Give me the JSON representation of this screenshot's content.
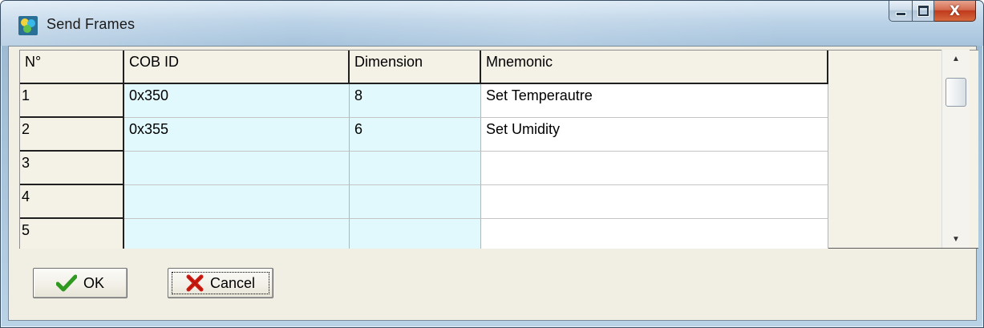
{
  "window": {
    "title": "Send Frames",
    "icons": {
      "app": "app-icon",
      "minimize": "minimize-icon",
      "maximize": "maximize-icon",
      "close": "close-icon",
      "close_glyph": "X"
    }
  },
  "grid": {
    "columns": [
      "N°",
      "COB ID",
      "Dimension",
      "Mnemonic"
    ],
    "rows": [
      {
        "n": "1",
        "cob_id": "0x350",
        "dimension": "8",
        "mnemonic": "Set Temperautre"
      },
      {
        "n": "2",
        "cob_id": "0x355",
        "dimension": "6",
        "mnemonic": "Set Umidity"
      },
      {
        "n": "3",
        "cob_id": "",
        "dimension": "",
        "mnemonic": ""
      },
      {
        "n": "4",
        "cob_id": "",
        "dimension": "",
        "mnemonic": ""
      },
      {
        "n": "5",
        "cob_id": "",
        "dimension": "",
        "mnemonic": ""
      }
    ],
    "colors": {
      "editable_cell": "#e1f9fd",
      "text_cell": "#ffffff",
      "fixed": "#f4f2e7"
    }
  },
  "buttons": {
    "ok": {
      "label": "OK",
      "icon": "checkmark-icon",
      "color": "#2f9a1f"
    },
    "cancel": {
      "label": "Cancel",
      "icon": "red-x-icon",
      "color": "#d11a10"
    }
  }
}
